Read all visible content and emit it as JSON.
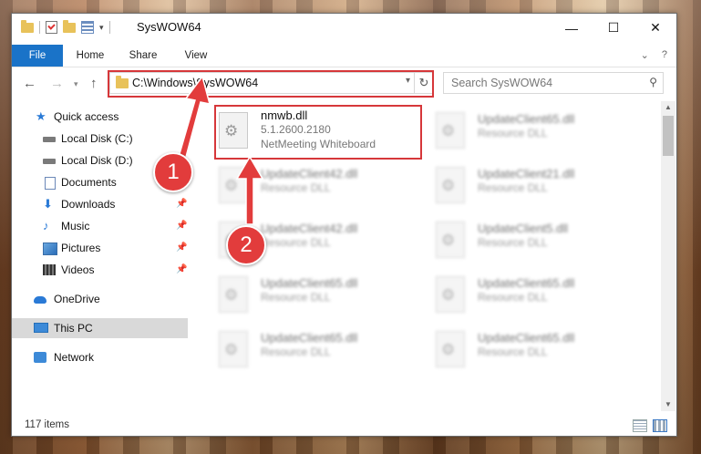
{
  "window": {
    "title": "SysWOW64",
    "controls": {
      "minimize": "—",
      "maximize": "☐",
      "close": "✕"
    }
  },
  "ribbon": {
    "tabs": [
      "File",
      "Home",
      "Share",
      "View"
    ],
    "help": "?"
  },
  "address": {
    "path": "C:\\Windows\\SysWOW64"
  },
  "search": {
    "placeholder": "Search SysWOW64"
  },
  "sidebar": {
    "items": [
      {
        "label": "Quick access",
        "icon": "star-icon"
      },
      {
        "label": "Local Disk (C:)",
        "icon": "drive-icon"
      },
      {
        "label": "Local Disk (D:)",
        "icon": "drive-icon"
      },
      {
        "label": "Documents",
        "icon": "document-icon"
      },
      {
        "label": "Downloads",
        "icon": "download-icon"
      },
      {
        "label": "Music",
        "icon": "music-icon"
      },
      {
        "label": "Pictures",
        "icon": "pictures-icon"
      },
      {
        "label": "Videos",
        "icon": "videos-icon"
      },
      {
        "label": "OneDrive",
        "icon": "cloud-icon"
      },
      {
        "label": "This PC",
        "icon": "computer-icon"
      },
      {
        "label": "Network",
        "icon": "network-icon"
      }
    ]
  },
  "files": [
    {
      "name": "nmwb.dll",
      "version": "5.1.2600.2180",
      "description": "NetMeeting Whiteboard"
    },
    {
      "name": "UpdateClient65.dll",
      "description": "Resource DLL"
    },
    {
      "name": "UpdateClient42.dll",
      "description": "Resource DLL"
    },
    {
      "name": "UpdateClient21.dll",
      "description": "Resource DLL"
    },
    {
      "name": "UpdateClient42.dll",
      "description": "Resource DLL"
    },
    {
      "name": "UpdateClient5.dll",
      "description": "Resource DLL"
    },
    {
      "name": "UpdateClient65.dll",
      "description": "Resource DLL"
    },
    {
      "name": "UpdateClient65.dll",
      "description": "Resource DLL"
    },
    {
      "name": "UpdateClient65.dll",
      "description": "Resource DLL"
    },
    {
      "name": "UpdateClient65.dll",
      "description": "Resource DLL"
    }
  ],
  "status": {
    "item_count": "117 items"
  },
  "callouts": [
    "1",
    "2"
  ],
  "colors": {
    "accent": "#1a73c8",
    "highlight": "#d6373a",
    "callout": "#e23c3c"
  }
}
